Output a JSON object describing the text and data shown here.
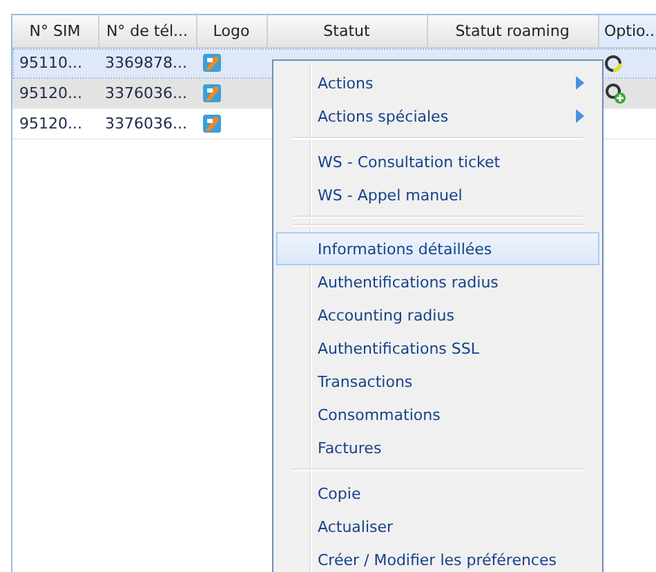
{
  "grid": {
    "columns": [
      {
        "label": "N° SIM",
        "active": false
      },
      {
        "label": "N° de tél...",
        "active": false
      },
      {
        "label": "Logo",
        "active": false
      },
      {
        "label": "Statut",
        "active": false
      },
      {
        "label": "Statut roaming",
        "active": false
      },
      {
        "label": "Optio...",
        "active": true
      }
    ],
    "rows": [
      {
        "sim": "95110...",
        "phone": "3369878...",
        "selected": true,
        "hovered": false,
        "kind": "loading"
      },
      {
        "sim": "95120...",
        "phone": "3376036...",
        "selected": false,
        "hovered": true,
        "kind": "add"
      },
      {
        "sim": "95120...",
        "phone": "3376036...",
        "selected": false,
        "hovered": false,
        "kind": "plain"
      }
    ]
  },
  "context_menu": {
    "items": [
      {
        "kind": "submenu",
        "label": "Actions",
        "selected": false
      },
      {
        "kind": "submenu",
        "label": "Actions spéciales",
        "selected": false
      },
      {
        "kind": "separator"
      },
      {
        "kind": "item",
        "label": "WS - Consultation ticket",
        "selected": false
      },
      {
        "kind": "item",
        "label": "WS - Appel manuel",
        "selected": false
      },
      {
        "kind": "separator"
      },
      {
        "kind": "separator"
      },
      {
        "kind": "item",
        "label": "Informations détaillées",
        "selected": true
      },
      {
        "kind": "item",
        "label": "Authentifications radius",
        "selected": false
      },
      {
        "kind": "item",
        "label": "Accounting radius",
        "selected": false
      },
      {
        "kind": "item",
        "label": "Authentifications SSL",
        "selected": false
      },
      {
        "kind": "item",
        "label": "Transactions",
        "selected": false
      },
      {
        "kind": "item",
        "label": "Consommations",
        "selected": false
      },
      {
        "kind": "item",
        "label": "Factures",
        "selected": false
      },
      {
        "kind": "separator"
      },
      {
        "kind": "item",
        "label": "Copie",
        "selected": false
      },
      {
        "kind": "item",
        "label": "Actualiser",
        "selected": false
      },
      {
        "kind": "item",
        "label": "Créer / Modifier les préférences",
        "selected": false
      }
    ]
  }
}
